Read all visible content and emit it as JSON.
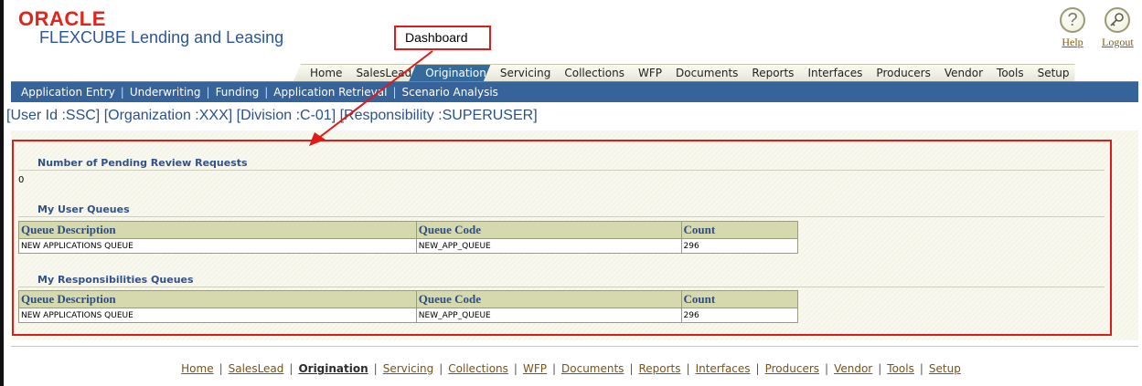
{
  "header": {
    "brand": "ORACLE",
    "product": "FLEXCUBE Lending and Leasing",
    "help_label": "Help",
    "logout_label": "Logout"
  },
  "annotation": {
    "label": "Dashboard",
    "color": "#e01919"
  },
  "tabs": [
    {
      "label": "Home",
      "active": false
    },
    {
      "label": "SalesLead",
      "active": false
    },
    {
      "label": "Origination",
      "active": true
    },
    {
      "label": "Servicing",
      "active": false
    },
    {
      "label": "Collections",
      "active": false
    },
    {
      "label": "WFP",
      "active": false
    },
    {
      "label": "Documents",
      "active": false
    },
    {
      "label": "Reports",
      "active": false
    },
    {
      "label": "Interfaces",
      "active": false
    },
    {
      "label": "Producers",
      "active": false
    },
    {
      "label": "Vendor",
      "active": false
    },
    {
      "label": "Tools",
      "active": false
    },
    {
      "label": "Setup",
      "active": false
    }
  ],
  "subnav": [
    "Application Entry",
    "Underwriting",
    "Funding",
    "Application Retrieval",
    "Scenario Analysis"
  ],
  "user_context": "[User Id :SSC] [Organization :XXX] [Division :C-01] [Responsibility :SUPERUSER]",
  "dashboard": {
    "pending_title": "Number of Pending Review Requests",
    "pending_count": "0",
    "user_queues_title": "My User Queues",
    "resp_queues_title": "My Responsibilities Queues",
    "columns": [
      "Queue Description",
      "Queue Code",
      "Count"
    ],
    "user_queues": [
      {
        "description": "NEW APPLICATIONS QUEUE",
        "code": "NEW_APP_QUEUE",
        "count": "296"
      }
    ],
    "resp_queues": [
      {
        "description": "NEW APPLICATIONS QUEUE",
        "code": "NEW_APP_QUEUE",
        "count": "296"
      }
    ]
  },
  "footer": {
    "links": [
      {
        "label": "Home",
        "current": false
      },
      {
        "label": "SalesLead",
        "current": false
      },
      {
        "label": "Origination",
        "current": true
      },
      {
        "label": "Servicing",
        "current": false
      },
      {
        "label": "Collections",
        "current": false
      },
      {
        "label": "WFP",
        "current": false
      },
      {
        "label": "Documents",
        "current": false
      },
      {
        "label": "Reports",
        "current": false
      },
      {
        "label": "Interfaces",
        "current": false
      },
      {
        "label": "Producers",
        "current": false
      },
      {
        "label": "Vendor",
        "current": false
      },
      {
        "label": "Tools",
        "current": false
      },
      {
        "label": "Setup",
        "current": false
      }
    ]
  },
  "colors": {
    "brand_red": "#e2241b",
    "nav_blue": "#35639a",
    "header_olive": "#d5d9ad"
  }
}
